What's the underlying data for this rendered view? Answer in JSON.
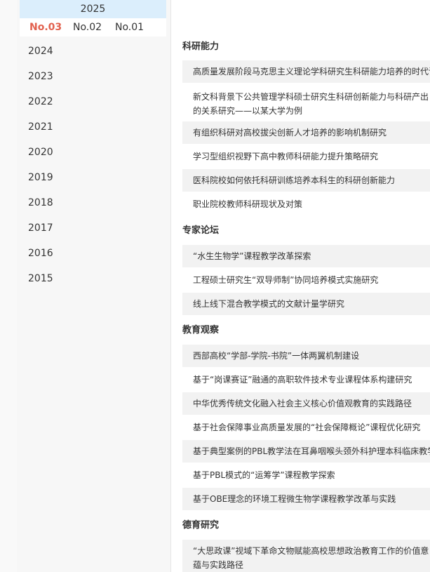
{
  "sidebar": {
    "current_year": "2025",
    "issues": [
      {
        "label": "No.03",
        "active": true
      },
      {
        "label": "No.02",
        "active": false
      },
      {
        "label": "No.01",
        "active": false
      }
    ],
    "years": [
      "2024",
      "2023",
      "2022",
      "2021",
      "2020",
      "2019",
      "2018",
      "2017",
      "2016",
      "2015"
    ]
  },
  "sections": [
    {
      "title": "科研能力",
      "articles": [
        "高质量发展阶段马克思主义理论学科研究生科研能力培养的时代诉求",
        "新文科背景下公共管理学科硕士研究生科研创新能力与科研产出的关系研究——以某大学为例",
        "有组织科研对高校拔尖创新人才培养的影响机制研究",
        "学习型组织视野下高中教师科研能力提升策略研究",
        "医科院校如何依托科研训练培养本科生的科研创新能力",
        "职业院校教师科研现状及对策"
      ]
    },
    {
      "title": "专家论坛",
      "articles": [
        "“水生生物学”课程教学改革探索",
        "工程硕士研究生“双导师制”协同培养模式实施研究",
        "线上线下混合教学模式的文献计量学研究"
      ]
    },
    {
      "title": "教育观察",
      "articles": [
        "西部高校“学部-学院-书院”一体两翼机制建设",
        "基于“岗课赛证”融通的高职软件技术专业课程体系构建研究",
        "中华优秀传统文化融入社会主义核心价值观教育的实践路径",
        "基于社会保障事业高质量发展的“社会保障概论”课程优化研究",
        "基于典型案例的PBL教学法在耳鼻咽喉头颈外科护理本科临床教学中的应用",
        "基于PBL模式的“运筹学”课程教学探索",
        "基于OBE理念的环境工程微生物学课程教学改革与实践"
      ]
    },
    {
      "title": "德育研究",
      "articles": [
        "“大思政课”视域下革命文物赋能高校思想政治教育工作的价值意蕴与实践路径"
      ]
    }
  ]
}
